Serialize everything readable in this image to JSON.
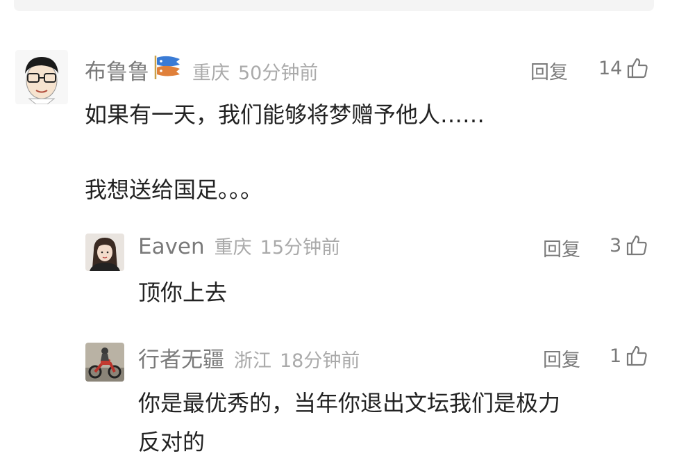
{
  "comments": [
    {
      "username": "布鲁鲁",
      "location": "重庆",
      "time": "50分钟前",
      "reply_label": "回复",
      "like_count": "14",
      "text_line1": "如果有一天，我们能够将梦赠予他人……",
      "text_line2": "我想送给国足。。。",
      "badge_icon": "koi-flag-icon",
      "avatar_icon": "cartoon-man-with-glasses-avatar"
    },
    {
      "username": "Eaven",
      "location": "重庆",
      "time": "15分钟前",
      "reply_label": "回复",
      "like_count": "3",
      "text": "顶你上去",
      "avatar_icon": "woman-photo-avatar"
    },
    {
      "username": "行者无疆",
      "location": "浙江",
      "time": "18分钟前",
      "reply_label": "回复",
      "like_count": "1",
      "text": "你是最优秀的，当年你退出文坛我们是极力\n反对的",
      "avatar_icon": "motorcycle-rider-avatar"
    }
  ],
  "icons": {
    "like": "thumbs-up-icon"
  },
  "colors": {
    "name": "#7a7a7a",
    "meta": "#aaaaaa",
    "text": "#222222"
  }
}
